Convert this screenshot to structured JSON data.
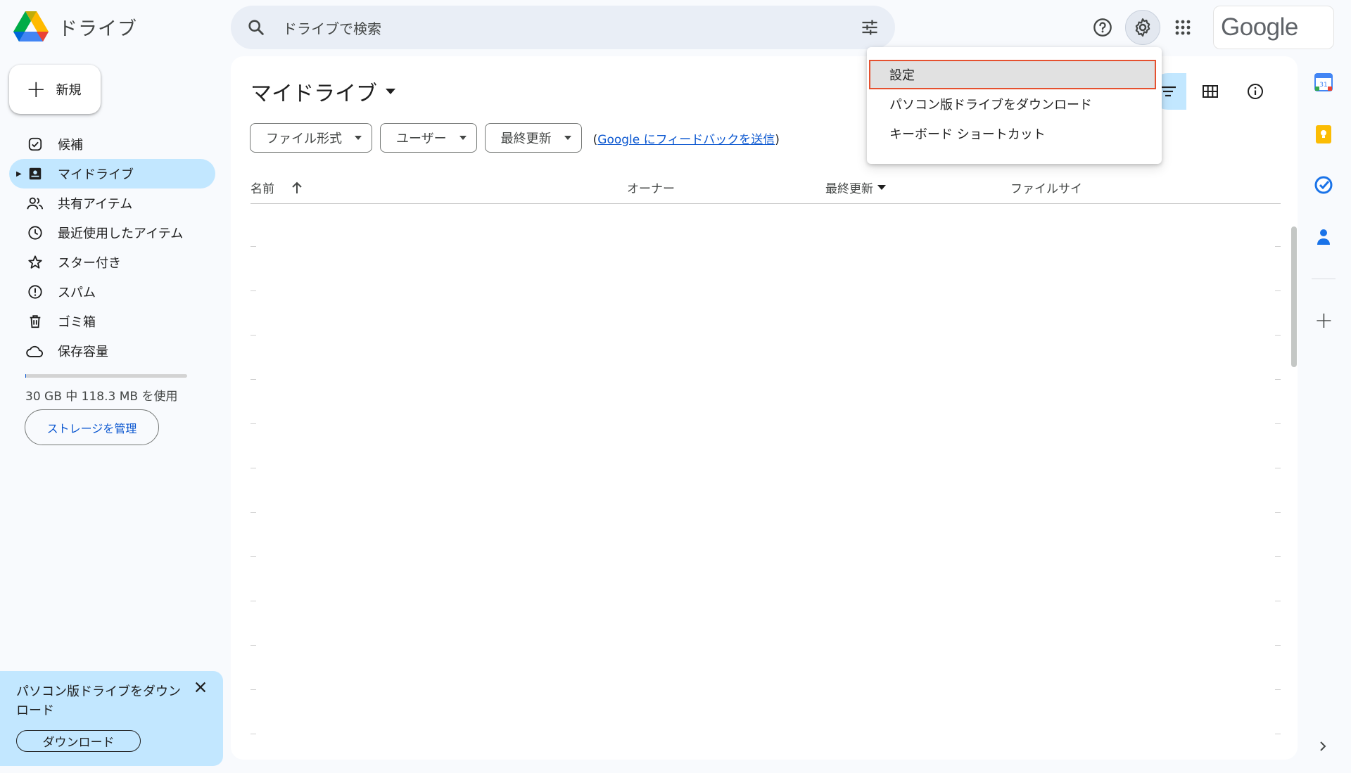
{
  "app": {
    "name": "ドライブ"
  },
  "header": {
    "search_placeholder": "ドライブで検索",
    "google_label": "Google"
  },
  "sidebar": {
    "new_label": "新規",
    "items": [
      {
        "label": "候補",
        "icon": "suggested-icon"
      },
      {
        "label": "マイドライブ",
        "icon": "my-drive-icon",
        "active": true
      },
      {
        "label": "共有アイテム",
        "icon": "shared-people-icon"
      },
      {
        "label": "最近使用したアイテム",
        "icon": "clock-icon"
      },
      {
        "label": "スター付き",
        "icon": "star-icon"
      },
      {
        "label": "スパム",
        "icon": "spam-icon"
      },
      {
        "label": "ゴミ箱",
        "icon": "trash-icon"
      },
      {
        "label": "保存容量",
        "icon": "cloud-icon"
      }
    ],
    "storage_text": "30 GB 中 118.3 MB を使用",
    "storage_fraction": 0.004,
    "manage_storage_label": "ストレージを管理"
  },
  "promo": {
    "text": "パソコン版ドライブをダウンロード",
    "button_label": "ダウンロード"
  },
  "main": {
    "title": "マイドライブ",
    "filters": [
      {
        "label": "ファイル形式"
      },
      {
        "label": "ユーザー"
      },
      {
        "label": "最終更新"
      }
    ],
    "feedback_open": "(",
    "feedback_link": "Google にフィードバックを送信",
    "feedback_close": ")",
    "columns": {
      "name": "名前",
      "owner": "オーナー",
      "modified": "最終更新",
      "size": "ファイルサイ"
    }
  },
  "settings_menu": {
    "items": [
      {
        "label": "設定",
        "highlighted": true
      },
      {
        "label": "パソコン版ドライブをダウンロード"
      },
      {
        "label": "キーボード ショートカット"
      }
    ]
  },
  "colors": {
    "accent": "#0b57d0",
    "active_nav": "#c2e7ff",
    "highlight_border": "#e5512f"
  }
}
